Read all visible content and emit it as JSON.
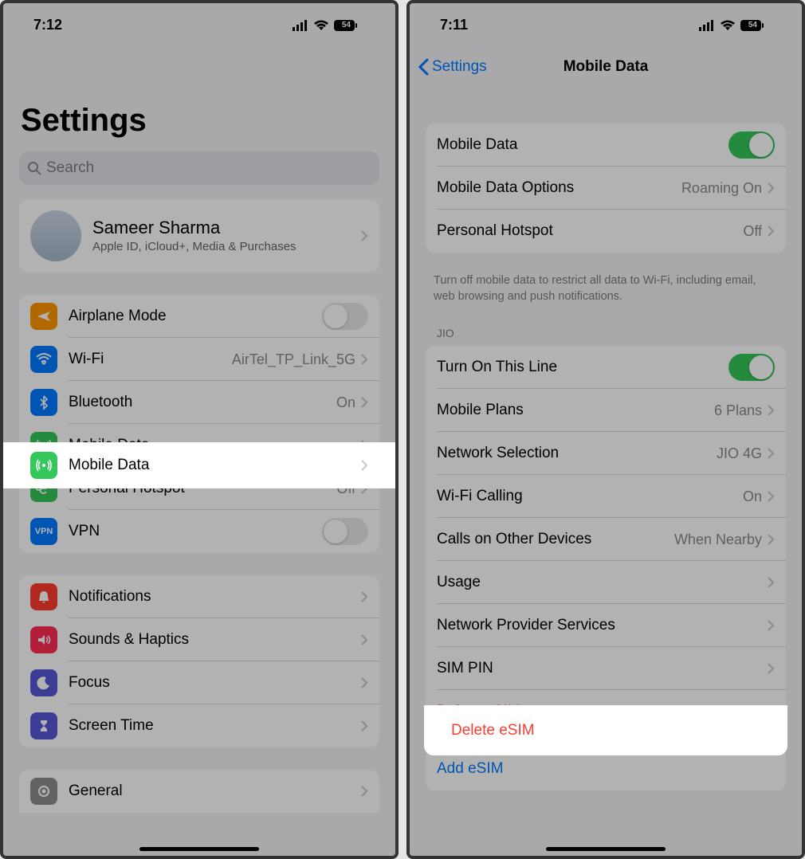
{
  "left": {
    "status_time": "7:12",
    "battery": "54",
    "title": "Settings",
    "search_placeholder": "Search",
    "apple_id": {
      "name": "Sameer Sharma",
      "sub": "Apple ID, iCloud+, Media & Purchases"
    },
    "group1": [
      {
        "label": "Airplane Mode",
        "kind": "toggle",
        "on": false,
        "icon": "airplane",
        "bg": "#ff9500"
      },
      {
        "label": "Wi-Fi",
        "value": "AirTel_TP_Link_5G",
        "icon": "wifi",
        "bg": "#007aff"
      },
      {
        "label": "Bluetooth",
        "value": "On",
        "icon": "bluetooth",
        "bg": "#007aff"
      },
      {
        "label": "Mobile Data",
        "highlight": true,
        "icon": "antenna",
        "bg": "#34c759"
      },
      {
        "label": "Personal Hotspot",
        "value": "Off",
        "icon": "link",
        "bg": "#34c759"
      },
      {
        "label": "VPN",
        "kind": "toggle",
        "on": false,
        "icon": "vpn",
        "bg": "#007aff"
      }
    ],
    "group2": [
      {
        "label": "Notifications",
        "icon": "bell",
        "bg": "#ff3b30"
      },
      {
        "label": "Sounds & Haptics",
        "icon": "speaker",
        "bg": "#ff2d55"
      },
      {
        "label": "Focus",
        "icon": "moon",
        "bg": "#5856d6"
      },
      {
        "label": "Screen Time",
        "icon": "hourglass",
        "bg": "#5856d6"
      }
    ],
    "group3": [
      {
        "label": "General",
        "icon": "gear",
        "bg": "#8e8e93"
      }
    ]
  },
  "right": {
    "status_time": "7:11",
    "battery": "54",
    "back": "Settings",
    "title": "Mobile Data",
    "group1": [
      {
        "label": "Mobile Data",
        "kind": "toggle",
        "on": true
      },
      {
        "label": "Mobile Data Options",
        "value": "Roaming On"
      },
      {
        "label": "Personal Hotspot",
        "value": "Off"
      }
    ],
    "footer1": "Turn off mobile data to restrict all data to Wi-Fi, including email, web browsing and push notifications.",
    "header2": "JIO",
    "group2": [
      {
        "label": "Turn On This Line",
        "kind": "toggle",
        "on": true
      },
      {
        "label": "Mobile Plans",
        "value": "6 Plans"
      },
      {
        "label": "Network Selection",
        "value": "JIO 4G"
      },
      {
        "label": "Wi-Fi Calling",
        "value": "On"
      },
      {
        "label": "Calls on Other Devices",
        "value": "When Nearby"
      },
      {
        "label": "Usage"
      },
      {
        "label": "Network Provider Services"
      },
      {
        "label": "SIM PIN"
      },
      {
        "label": "Delete eSIM",
        "style": "delete",
        "highlight": true
      }
    ],
    "group3": [
      {
        "label": "Add eSIM",
        "style": "blue"
      }
    ]
  }
}
